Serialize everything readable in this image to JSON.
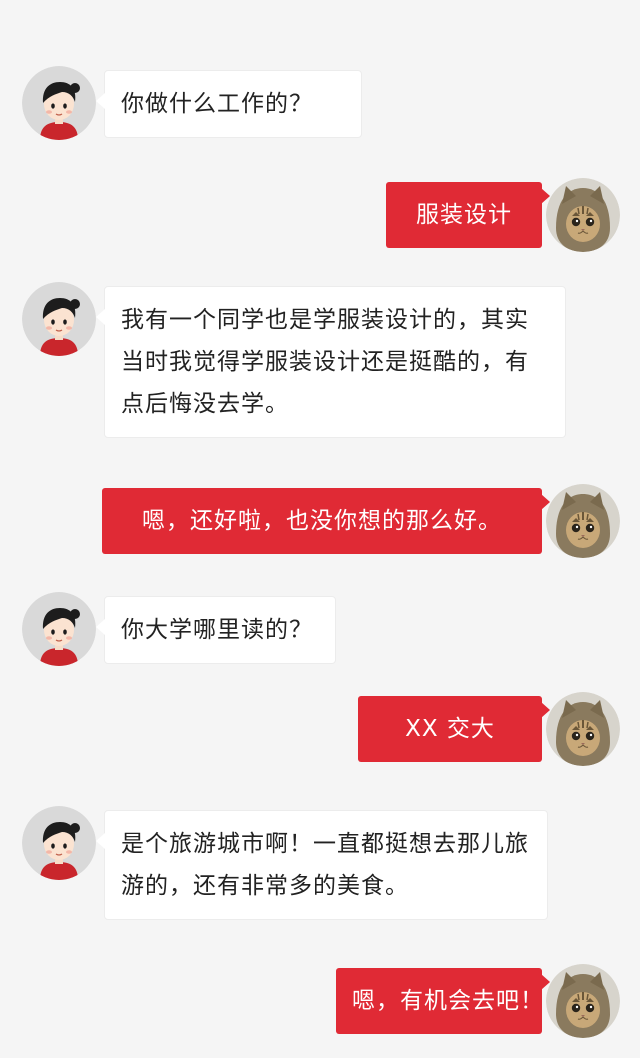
{
  "colors": {
    "background": "#f5f5f5",
    "incoming_bubble": "#ffffff",
    "outgoing_bubble": "#e02a35",
    "outgoing_text": "#ffffff",
    "incoming_text": "#222222"
  },
  "contacts": {
    "other": {
      "avatar_icon": "cartoon-girl-avatar-icon"
    },
    "self": {
      "avatar_icon": "kitten-avatar-icon"
    }
  },
  "messages": [
    {
      "side": "left",
      "lines": [
        "你做什么工作的？"
      ]
    },
    {
      "side": "right",
      "lines": [
        "服装设计"
      ]
    },
    {
      "side": "left",
      "lines": [
        "我有一个同学也是学服装设计的，其实",
        "当时我觉得学服装设计还是挺酷的，有",
        "点后悔没去学。"
      ]
    },
    {
      "side": "right",
      "lines": [
        "嗯，还好啦，也没你想的那么好。"
      ]
    },
    {
      "side": "left",
      "lines": [
        "你大学哪里读的？"
      ]
    },
    {
      "side": "right",
      "lines": [
        "XX 交大"
      ]
    },
    {
      "side": "left",
      "lines": [
        "是个旅游城市啊！一直都挺想去那儿旅",
        "游的，还有非常多的美食。"
      ]
    },
    {
      "side": "right",
      "lines": [
        "嗯，有机会去吧！"
      ]
    }
  ]
}
